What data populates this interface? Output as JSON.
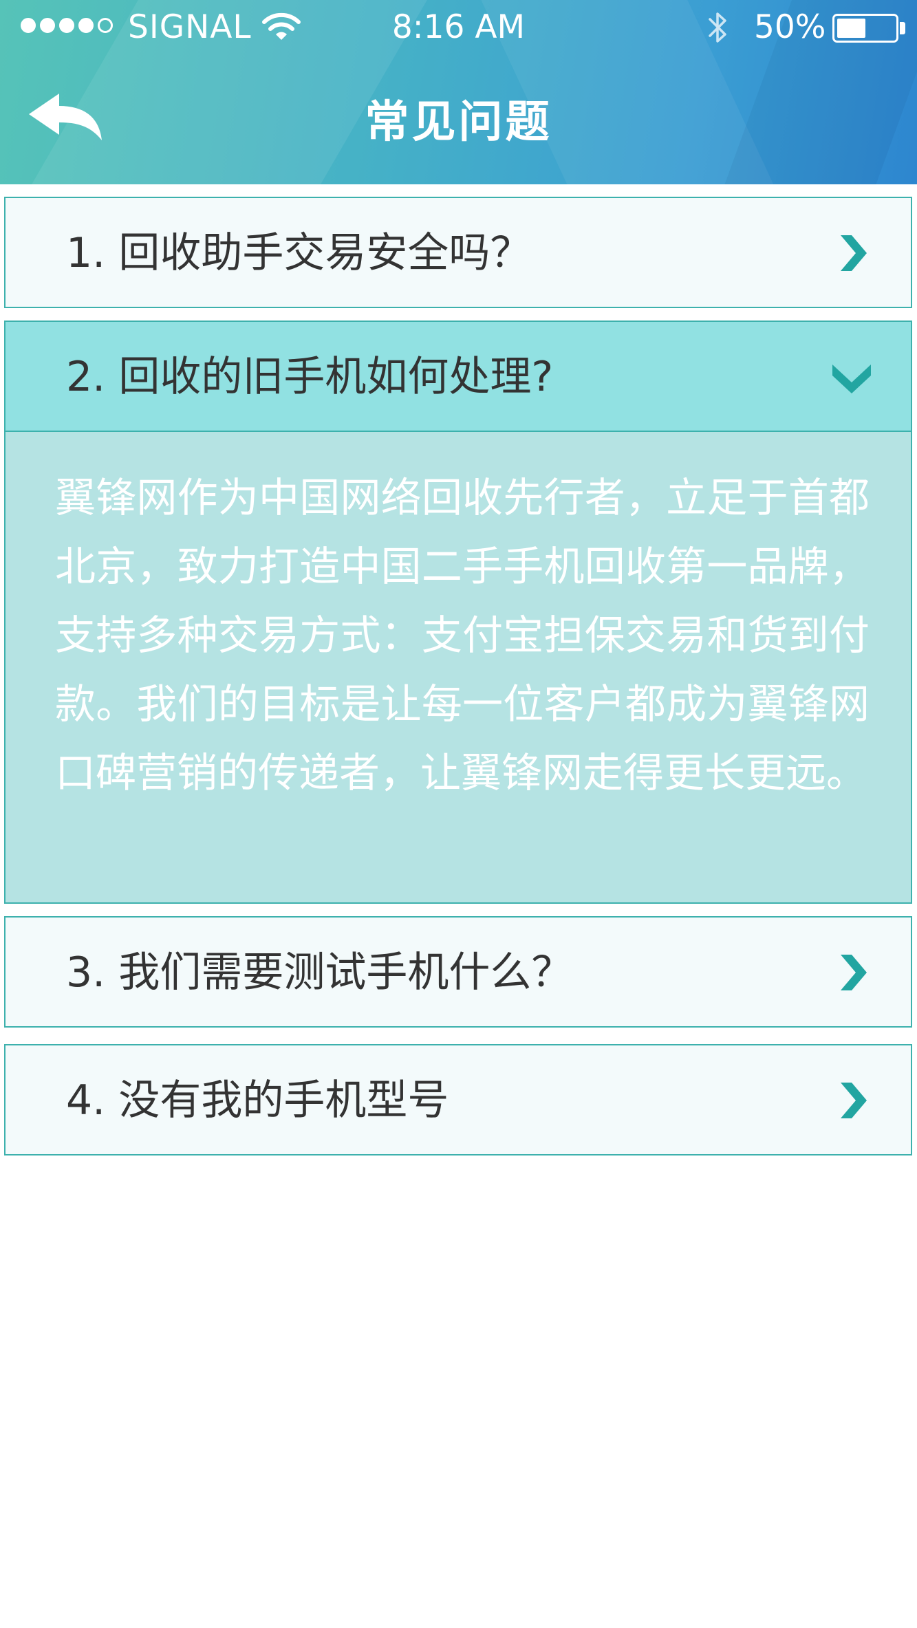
{
  "status_bar": {
    "carrier": "SIGNAL",
    "time": "8:16 AM",
    "battery_percent": "50%",
    "battery_level": 0.5,
    "signal_bars_filled": 4,
    "signal_bars_total": 5
  },
  "nav": {
    "title": "常见问题",
    "back_icon": "back-arrow-icon"
  },
  "colors": {
    "header_gradient_start": "#56c3b8",
    "header_gradient_end": "#2d86cf",
    "item_border": "#3db1ad",
    "item_background": "#f3fafb",
    "expanded_header_background": "#91e1e2",
    "expanded_body_background": "#b5e3e3",
    "chevron": "#22a5a1"
  },
  "faq": [
    {
      "question": "1. 回收助手交易安全吗？",
      "expanded": false,
      "icon": "chevron-right-icon"
    },
    {
      "question": "2. 回收的旧手机如何处理?",
      "expanded": true,
      "icon": "chevron-down-icon",
      "answer": "翼锋网作为中国网络回收先行者，立足于首都北京，致力打造中国二手手机回收第一品牌，支持多种交易方式：支付宝担保交易和货到付款。我们的目标是让每一位客户都成为翼锋网口碑营销的传递者，让翼锋网走得更长更远。"
    },
    {
      "question": "3. 我们需要测试手机什么？",
      "expanded": false,
      "icon": "chevron-right-icon"
    },
    {
      "question": "4. 没有我的手机型号",
      "expanded": false,
      "icon": "chevron-right-icon"
    }
  ]
}
